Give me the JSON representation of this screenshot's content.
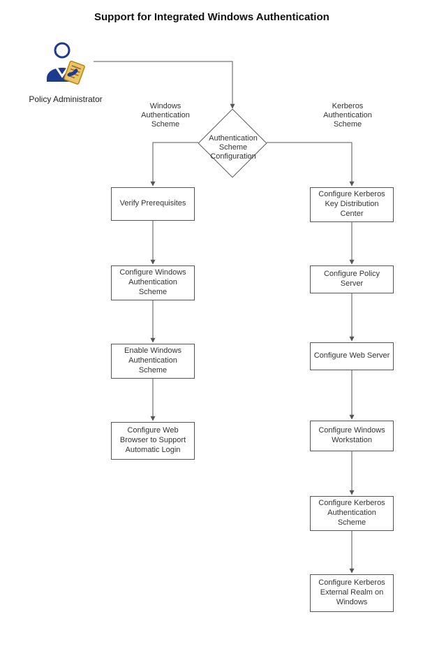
{
  "title": "Support for Integrated Windows Authentication",
  "actor": "Policy Administrator",
  "decision": "Authentication Scheme Configuration",
  "branch_left": "Windows Authentication Scheme",
  "branch_right": "Kerberos Authentication Scheme",
  "left_steps": {
    "s1": "Verify Prerequisites",
    "s2": "Configure Windows Authentication Scheme",
    "s3": "Enable Windows Authentication Scheme",
    "s4": "Configure Web Browser to Support Automatic Login"
  },
  "right_steps": {
    "s1": "Configure Kerberos Key Distribution Center",
    "s2": "Configure Policy Server",
    "s3": "Configure Web Server",
    "s4": "Configure Windows Workstation",
    "s5": "Configure Kerberos Authentication Scheme",
    "s6": "Configure Kerberos External Realm on Windows"
  }
}
